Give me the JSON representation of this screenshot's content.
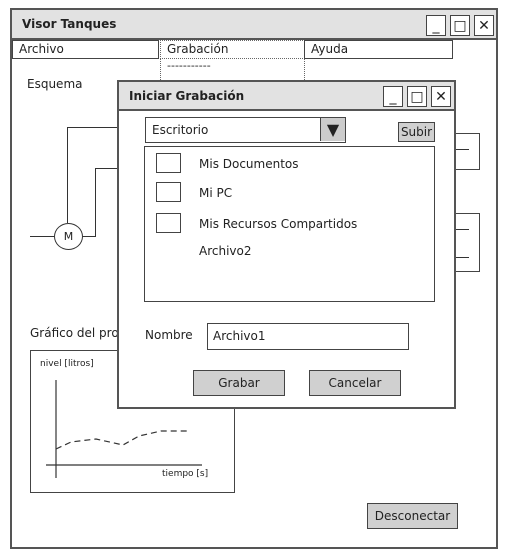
{
  "main_window": {
    "title": "Visor Tanques",
    "menu": [
      {
        "label": "Archivo"
      },
      {
        "label": "Grabación"
      },
      {
        "label": "Ayuda"
      }
    ],
    "menu_dropdown_separator": "-----------",
    "schema_label": "Esquema",
    "motor_label": "M",
    "chart_section_label": "Gráfico del proc",
    "chart": {
      "ylabel": "nivel [litros]",
      "xlabel": "tiempo [s]"
    },
    "disconnect_label": "Desconectar"
  },
  "dialog": {
    "title": "Iniciar Grabación",
    "location": "Escritorio",
    "up_label": "Subir",
    "items": [
      {
        "label": "Mis Documentos",
        "icon": "folder-icon"
      },
      {
        "label": "Mi PC",
        "icon": "folder-icon"
      },
      {
        "label": "Mis Recursos Compartidos",
        "icon": "folder-icon"
      },
      {
        "label": "Archivo2",
        "icon": ""
      }
    ],
    "name_label": "Nombre",
    "name_value": "Archivo1",
    "record_label": "Grabar",
    "cancel_label": "Cancelar"
  }
}
